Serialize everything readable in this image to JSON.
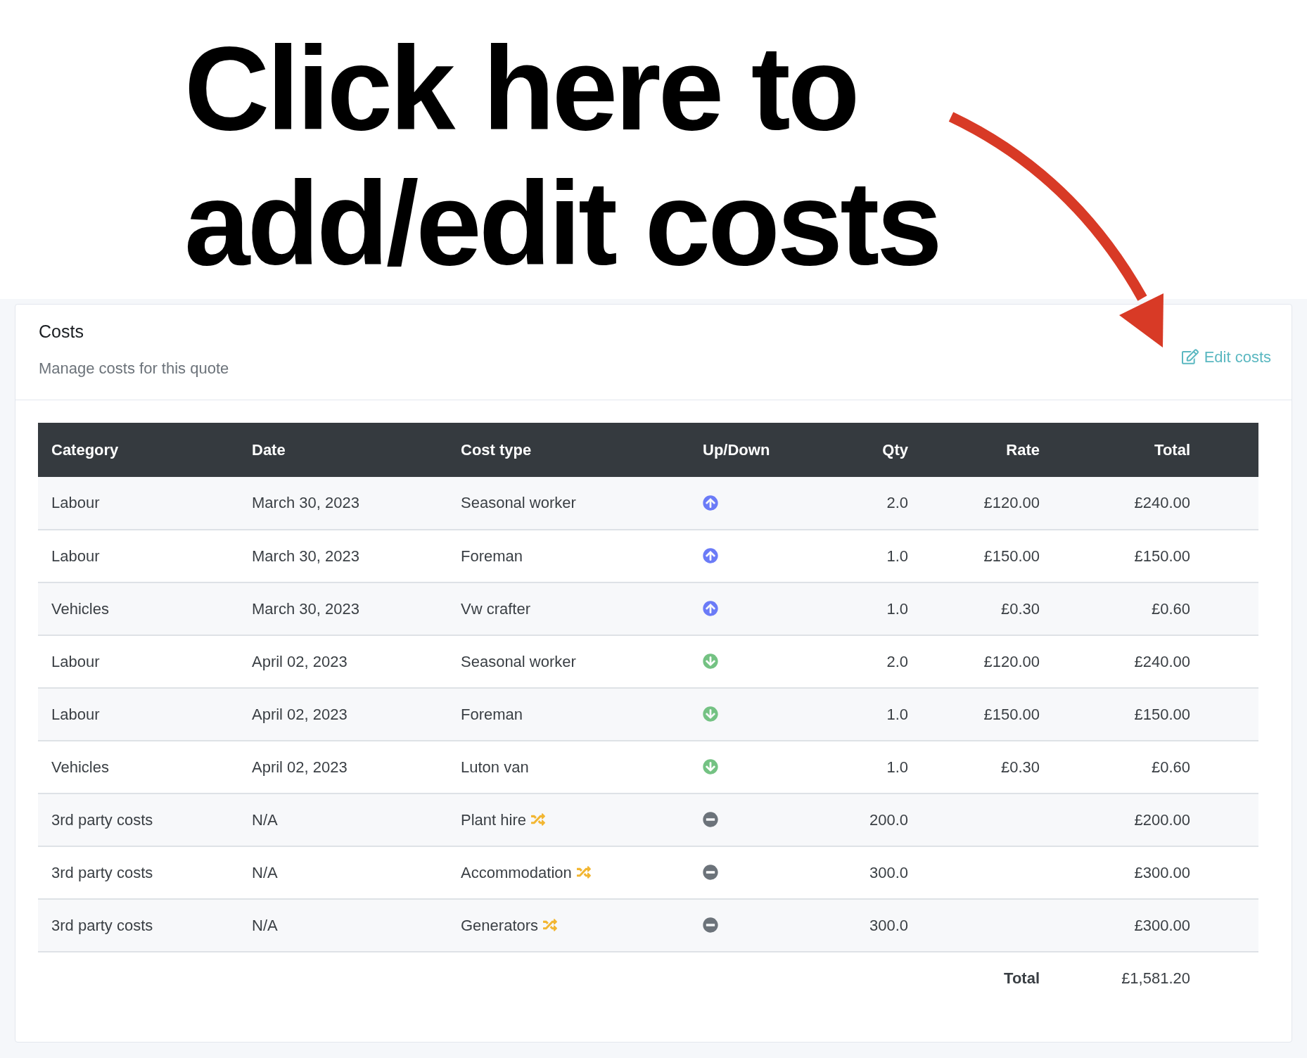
{
  "callout": {
    "lines": [
      "Click here to",
      "add/edit costs"
    ]
  },
  "card": {
    "title": "Costs",
    "subtitle": "Manage costs for this quote",
    "edit_link": "Edit costs"
  },
  "table": {
    "columns": [
      "Category",
      "Date",
      "Cost type",
      "Up/Down",
      "Qty",
      "Rate",
      "Total"
    ],
    "rows": [
      {
        "category": "Labour",
        "date": "March 30, 2023",
        "cost_type": "Seasonal worker",
        "shuffle": false,
        "kind": "up",
        "qty": "2.0",
        "rate": "£120.00",
        "total": "£240.00"
      },
      {
        "category": "Labour",
        "date": "March 30, 2023",
        "cost_type": "Foreman",
        "shuffle": false,
        "kind": "up",
        "qty": "1.0",
        "rate": "£150.00",
        "total": "£150.00"
      },
      {
        "category": "Vehicles",
        "date": "March 30, 2023",
        "cost_type": "Vw crafter",
        "shuffle": false,
        "kind": "up",
        "qty": "1.0",
        "rate": "£0.30",
        "total": "£0.60"
      },
      {
        "category": "Labour",
        "date": "April 02, 2023",
        "cost_type": "Seasonal worker",
        "shuffle": false,
        "kind": "down",
        "qty": "2.0",
        "rate": "£120.00",
        "total": "£240.00"
      },
      {
        "category": "Labour",
        "date": "April 02, 2023",
        "cost_type": "Foreman",
        "shuffle": false,
        "kind": "down",
        "qty": "1.0",
        "rate": "£150.00",
        "total": "£150.00"
      },
      {
        "category": "Vehicles",
        "date": "April 02, 2023",
        "cost_type": "Luton van",
        "shuffle": false,
        "kind": "down",
        "qty": "1.0",
        "rate": "£0.30",
        "total": "£0.60"
      },
      {
        "category": "3rd party costs",
        "date": "N/A",
        "cost_type": "Plant hire",
        "shuffle": true,
        "kind": "none",
        "qty": "200.0",
        "total": "£200.00"
      },
      {
        "category": "3rd party costs",
        "date": "N/A",
        "cost_type": "Accommodation",
        "shuffle": true,
        "kind": "none",
        "qty": "300.0",
        "total": "£300.00"
      },
      {
        "category": "3rd party costs",
        "date": "N/A",
        "cost_type": "Generators",
        "shuffle": true,
        "kind": "none",
        "qty": "300.0",
        "total": "£300.00"
      }
    ],
    "footer": {
      "label": "Total",
      "value": "£1,581.20"
    }
  }
}
